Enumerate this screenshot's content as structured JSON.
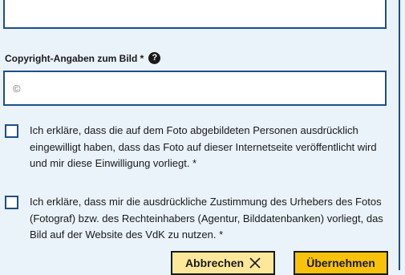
{
  "form": {
    "copyright_label": "Copyright-Angaben zum Bild *",
    "help_icon": "?",
    "copyright_value": "©",
    "consent_persons_text": "Ich erkläre, dass die auf dem Foto abgebildeten Personen ausdrücklich eingewilligt haben, dass das Foto auf dieser Internetseite veröffentlicht wird und mir diese Einwilligung vorliegt. *",
    "consent_rights_text": "Ich erkläre, dass mir die ausdrückliche Zustimmung des Urhebers des Fotos (Fotograf) bzw. des Rechteinhabers (Agentur, Bilddatenbanken) vorliegt, das Bild auf der Website des VdK zu nutzen. *"
  },
  "buttons": {
    "cancel_label": "Abbrechen",
    "cancel_icon": "close-icon",
    "apply_label": "Übernehmen"
  },
  "colors": {
    "background": "#eaf2fa",
    "border": "#1f4f86",
    "cancel_button": "#fde89a",
    "apply_button": "#f9c20a"
  }
}
